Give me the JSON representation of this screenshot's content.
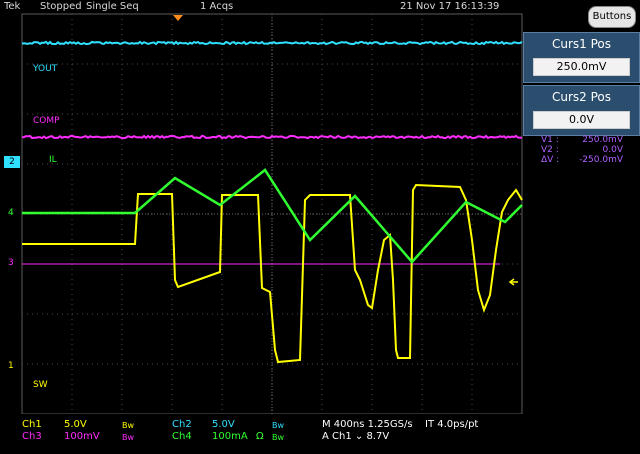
{
  "status_bar": {
    "brand": "Tek",
    "acq_state": "Stopped",
    "acq_mode": "Single Seq",
    "acq_count": "1 Acqs",
    "timestamp": "21 Nov 17 16:13:39"
  },
  "buttons_label": "Buttons",
  "cursors": {
    "curs1": {
      "title": "Curs1 Pos",
      "value": "250.0mV"
    },
    "curs2": {
      "title": "Curs2 Pos",
      "value": "0.0V"
    },
    "readout": [
      {
        "label": "V1 :",
        "value": "250.0mV"
      },
      {
        "label": "V2 :",
        "value": "0.0V"
      },
      {
        "label": "ΔV :",
        "value": "-250.0mV"
      }
    ]
  },
  "trace_labels": {
    "vout": "YOUT",
    "comp": "COMP",
    "il": "IL",
    "sw": "SW"
  },
  "channel_markers": {
    "ch2": "2",
    "ch4": "4",
    "ch3": "3",
    "ch1": "1"
  },
  "channels": {
    "ch1": {
      "name": "Ch1",
      "scale": "5.0V",
      "bw": "Bw"
    },
    "ch2": {
      "name": "Ch2",
      "scale": "5.0V",
      "bw": "Bw"
    },
    "ch3": {
      "name": "Ch3",
      "scale": "100mV",
      "bw": "Bw"
    },
    "ch4": {
      "name": "Ch4",
      "scale": "100mA",
      "unit": "Ω",
      "bw": "Bw"
    }
  },
  "timebase": {
    "bw1": "Bw",
    "bw2": "Bw",
    "main": "M 400ns 1.25GS/s",
    "interp": "IT 4.0ps/pt",
    "trigger": "A  Ch1  ⌄  8.7V"
  },
  "colors": {
    "ch1": "#ffff00",
    "ch2": "#30e0ff",
    "ch3": "#ff2cff",
    "ch4": "#30ff30",
    "grid": "#5a5a5a",
    "panel": "#2b4e6e"
  },
  "icons": {
    "trigger_pos": "orange-triangle-icon",
    "trigger_level": "left-arrow-icon"
  }
}
